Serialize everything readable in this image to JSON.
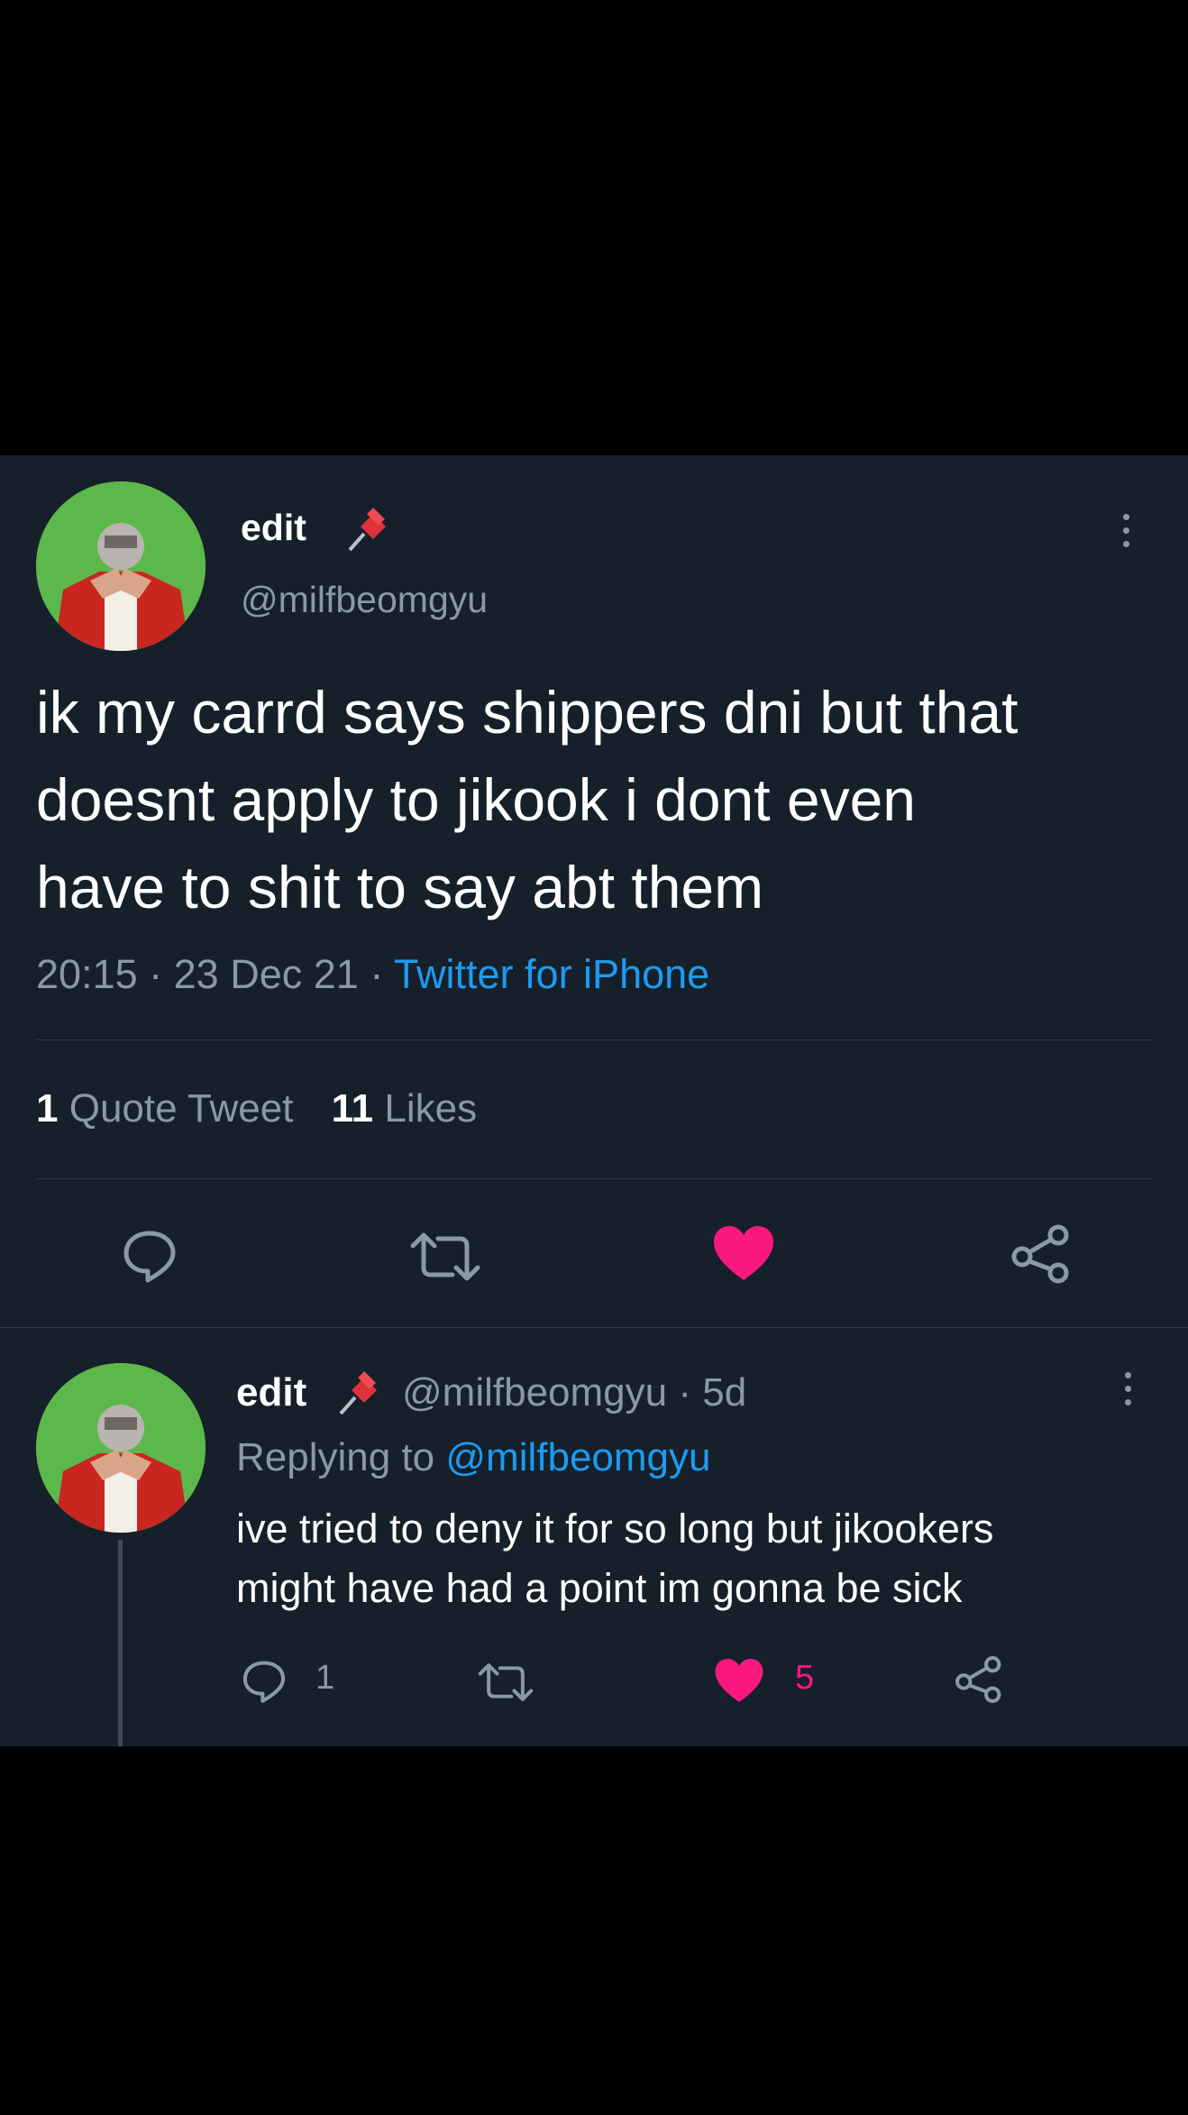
{
  "tweet": {
    "display_name": "edit",
    "name_emoji_icon": "pushpin-icon",
    "handle": "@milfbeomgyu",
    "text_lines": [
      "ik my carrd says shippers dni but that",
      "doesnt apply to jikook i dont even",
      "have to shit to say abt them"
    ],
    "time": "20:15",
    "date": "23 Dec 21",
    "source": "Twitter for iPhone",
    "separator": "·",
    "quote_count": "1",
    "quote_label": "Quote Tweet",
    "like_count": "11",
    "like_label": "Likes",
    "liked": true
  },
  "reply": {
    "display_name": "edit",
    "handle": "@milfbeomgyu",
    "separator": "·",
    "age": "5d",
    "replying_prefix": "Replying to",
    "replying_handle": "@milfbeomgyu",
    "text_lines": [
      "ive tried to deny it for so long but jikookers",
      "might have had a point im gonna be sick"
    ],
    "reply_count": "1",
    "like_count": "5",
    "liked": true
  },
  "colors": {
    "background": "#15202b",
    "outer": "#000000",
    "accent_link": "#1d9bf0",
    "like_pink": "#f91880",
    "muted": "#8b98a5"
  }
}
